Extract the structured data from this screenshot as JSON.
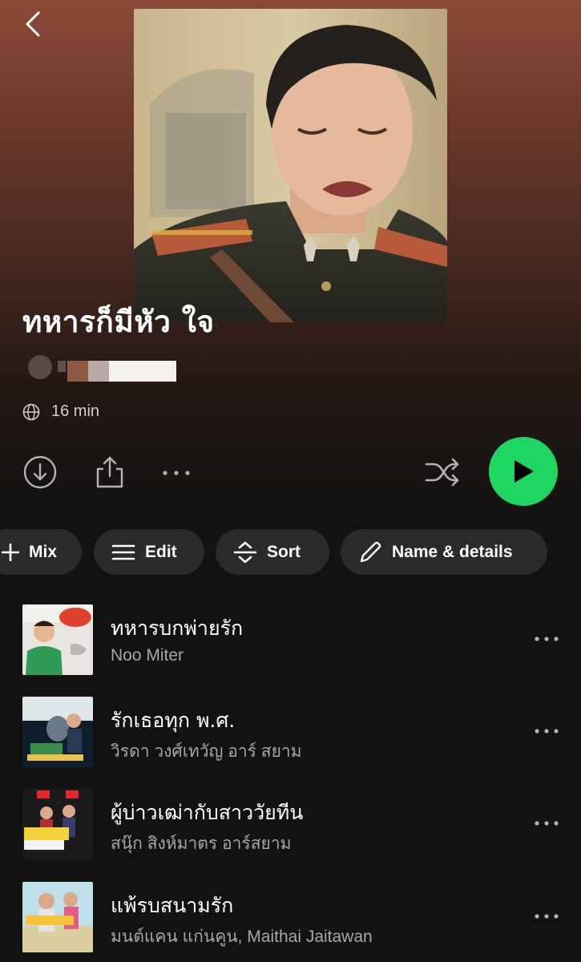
{
  "playlist": {
    "title": "ทหารก็มีหัว ใจ",
    "duration": "16 min"
  },
  "icons": {
    "back": "chevron-left-icon",
    "globe": "globe-icon",
    "download": "download-icon",
    "share": "share-icon",
    "more": "more-horizontal-icon",
    "shuffle": "shuffle-icon",
    "play": "play-icon"
  },
  "colors": {
    "accent": "#1ed760",
    "background": "#121212",
    "chip": "#2a2a2a",
    "secondary_text": "#a7a7a7"
  },
  "chips": [
    {
      "label": "Mix",
      "icon": "plus-icon"
    },
    {
      "label": "Edit",
      "icon": "list-icon"
    },
    {
      "label": "Sort",
      "icon": "sort-icon"
    },
    {
      "label": "Name & details",
      "icon": "pencil-icon"
    }
  ],
  "tracks": [
    {
      "title": "ทหารบกพ่ายรัก",
      "artist": "Noo Miter"
    },
    {
      "title": "รักเธอทุก พ.ศ.",
      "artist": "วิรดา วงศ์เทวัญ อาร์ สยาม"
    },
    {
      "title": "ผู้บ่าวเฒ่ากับสาววัยทีน",
      "artist": "สนุ๊ก สิงห์มาตร อาร์สยาม"
    },
    {
      "title": "แพ้รบสนามรัก",
      "artist": "มนต์แคน แก่นคูน, Maithai Jaitawan"
    }
  ]
}
